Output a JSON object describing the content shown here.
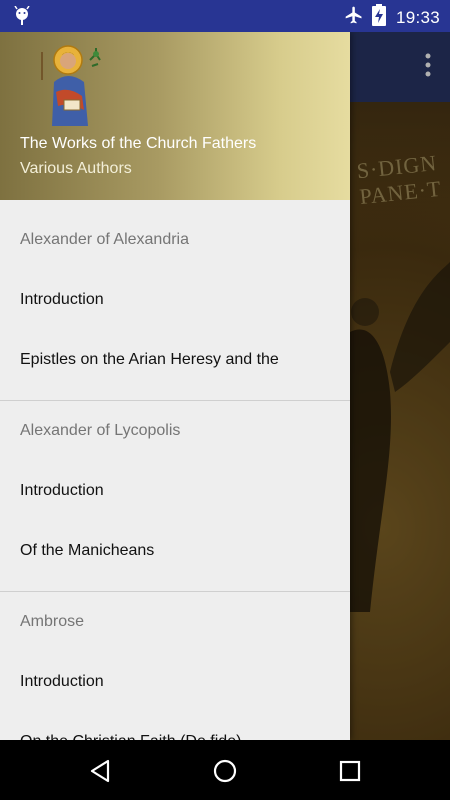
{
  "status_bar": {
    "time": "19:33",
    "icons": [
      "android-debug-icon",
      "airplane-mode-icon",
      "battery-charging-icon"
    ]
  },
  "background": {
    "mosaic_text_line1": "S·DIGN",
    "mosaic_text_line2": "PANE·T"
  },
  "drawer": {
    "header": {
      "title": "The Works of the Church Fathers",
      "subtitle": "Various Authors",
      "icon": "saint-icon"
    },
    "sections": [
      {
        "label": "Alexander of Alexandria",
        "items": [
          "Introduction",
          "Epistles on the Arian Heresy and the"
        ]
      },
      {
        "label": "Alexander of Lycopolis",
        "items": [
          "Introduction",
          "Of the Manicheans"
        ]
      },
      {
        "label": "Ambrose",
        "items": [
          "Introduction",
          "On the Christian Faith (De fide)"
        ]
      }
    ]
  },
  "nav_bar": {
    "buttons": [
      "back-icon",
      "home-icon",
      "recents-icon"
    ]
  },
  "colors": {
    "status_bar": "#283593",
    "drawer_bg": "#eeeeee",
    "header_gradient_start": "#7e7140",
    "header_gradient_end": "#e6dca0",
    "section_label": "#757575"
  }
}
